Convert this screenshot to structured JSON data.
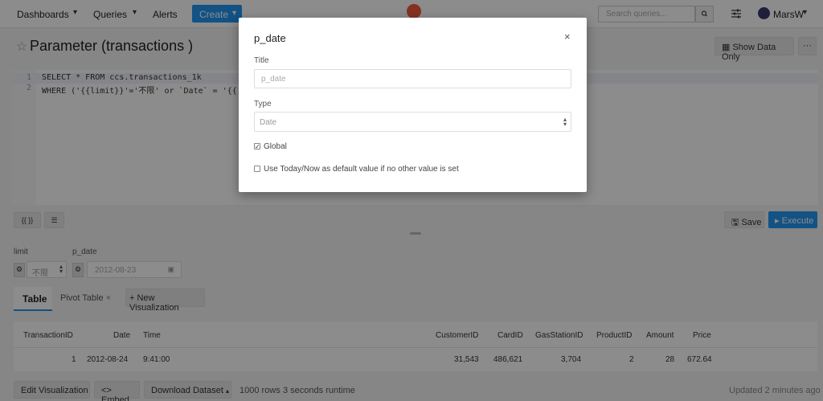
{
  "navbar": {
    "dashboards": "Dashboards",
    "queries": "Queries",
    "alerts": "Alerts",
    "create": "Create",
    "search_placeholder": "Search queries...",
    "username": "MarsW"
  },
  "query": {
    "title": "Parameter (transactions )",
    "show_data_only": "Show Data Only",
    "more": "···",
    "line1_num": "1",
    "line2_num": "2",
    "line1": "SELECT * FROM ccs.transactions_1k",
    "line2": "WHERE ('{{limit}}'='不限' or `Date` = '{{ p"
  },
  "editor_tools": {
    "params_btn": "{{ }}",
    "format_btn": "☰"
  },
  "actions": {
    "save": "Save",
    "execute": "Execute"
  },
  "params": {
    "limit_label": "limit",
    "limit_value": "不限",
    "p_date_label": "p_date",
    "p_date_value": "2012-08-23"
  },
  "tabs": {
    "table": "Table",
    "pivot": "Pivot Table",
    "new_viz": "+ New Visualization"
  },
  "table": {
    "headers": [
      "TransactionID",
      "Date",
      "Time",
      "CustomerID",
      "CardID",
      "GasStationID",
      "ProductID",
      "Amount",
      "Price"
    ],
    "row": [
      "1",
      "2012-08-24",
      "9:41:00",
      "31,543",
      "486,621",
      "3,704",
      "2",
      "28",
      "672.64"
    ]
  },
  "footer": {
    "edit_viz": "Edit Visualization",
    "embed": "<> Embed",
    "download": "Download Dataset",
    "rows": "1000 rows",
    "runtime": "3 seconds runtime",
    "updated": "Updated 2 minutes ago"
  },
  "modal": {
    "title": "p_date",
    "close": "×",
    "title_label": "Title",
    "title_placeholder": "p_date",
    "type_label": "Type",
    "type_value": "Date",
    "global_label": "Global",
    "global_checked": true,
    "today_label": "Use Today/Now as default value if no other value is set",
    "today_checked": false
  },
  "colors": {
    "accent": "#2196f3",
    "logo": "#f05a3c"
  }
}
